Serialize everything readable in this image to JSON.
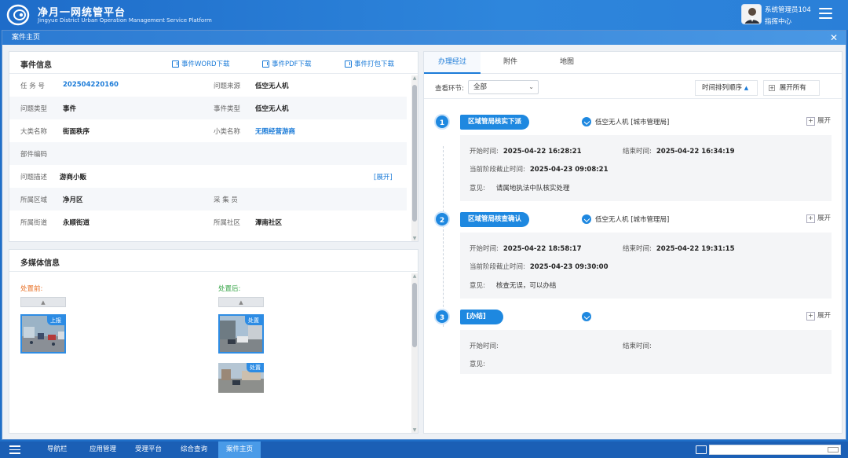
{
  "header": {
    "title_cn": "净月一网统管平台",
    "title_en": "Jingyue District Urban Operation Management Service Platform",
    "user_name": "系统管理员104",
    "user_role": "指挥中心"
  },
  "window": {
    "title": "案件主页",
    "close": "✕"
  },
  "event_info": {
    "title": "事件信息",
    "downloads": [
      "事件WORD下载",
      "事件PDF下载",
      "事件打包下载"
    ],
    "rows": [
      {
        "l1": "任 务 号",
        "v1": "202504220160",
        "l2": "问题来源",
        "v2": "低空无人机"
      },
      {
        "l1": "问题类型",
        "v1": "事件",
        "l2": "事件类型",
        "v2": "低空无人机"
      },
      {
        "l1": "大类名称",
        "v1": "街面秩序",
        "l2": "小类名称",
        "v2": "无照经营游商"
      },
      {
        "l1": "部件编码",
        "v1": "",
        "l2": "",
        "v2": ""
      },
      {
        "l1": "问题描述",
        "v1": "游商小贩",
        "l2": "",
        "v2": ""
      },
      {
        "l1": "所属区域",
        "v1": "净月区",
        "l2": "采 集 员",
        "v2": ""
      },
      {
        "l1": "所属街道",
        "v1": "永顺街道",
        "l2": "所属社区",
        "v2": "潭南社区"
      }
    ],
    "expand": "[展开]"
  },
  "media": {
    "title": "多媒体信息",
    "before_label": "处置前:",
    "after_label": "处置后:",
    "up_arrow": "▲",
    "before_tag": "上报",
    "after_tag": "处置"
  },
  "process": {
    "tabs": [
      "办理经过",
      "附件",
      "地图"
    ],
    "filter_label": "查看环节:",
    "filter_value": "全部",
    "sort_label": "时间排列顺序",
    "expand_all": "展开所有",
    "expand": "展开",
    "labels": {
      "start": "开始时间:",
      "end": "结束时间:",
      "deadline": "当前阶段截止时间:",
      "opinion": "意见:"
    },
    "steps": [
      {
        "num": "1",
        "name": "区域管局核实下派",
        "user": "低空无人机 [城市管理局]",
        "start": "2025-04-22 16:28:21",
        "end": "2025-04-22 16:34:19",
        "deadline": "2025-04-23 09:08:21",
        "opinion": "请属地执法中队核实处理"
      },
      {
        "num": "2",
        "name": "区域管局核查确认",
        "user": "低空无人机 [城市管理局]",
        "start": "2025-04-22 18:58:17",
        "end": "2025-04-22 19:31:15",
        "deadline": "2025-04-23 09:30:00",
        "opinion": "核查无误，可以办结"
      },
      {
        "num": "3",
        "name": "[办结]",
        "user": "",
        "start": "",
        "end": "",
        "deadline": "",
        "opinion": ""
      }
    ]
  },
  "taskbar": {
    "items": [
      "导航栏",
      "应用管理",
      "受理平台",
      "综合查询",
      "案件主页"
    ]
  },
  "colors": {
    "primary": "#1e88e0",
    "header": "#2b7ad2",
    "link": "#1b7bd8"
  }
}
